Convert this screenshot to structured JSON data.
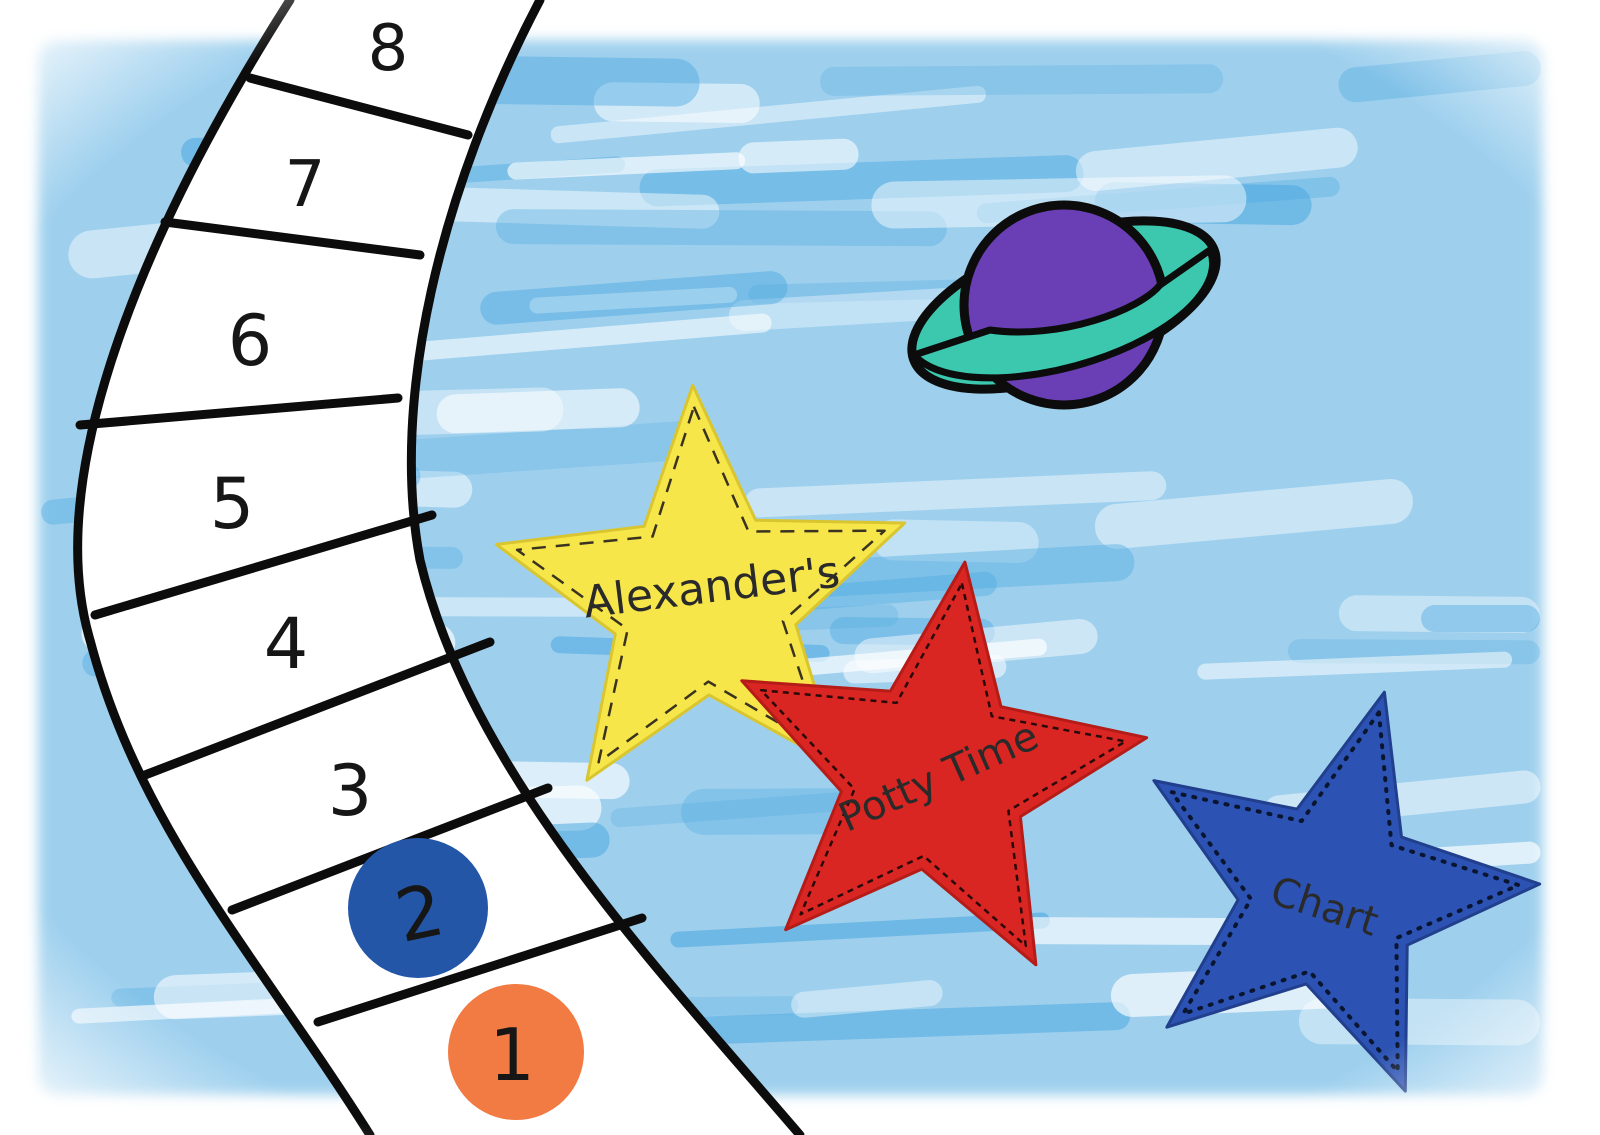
{
  "track": {
    "squares": [
      "1",
      "2",
      "3",
      "4",
      "5",
      "6",
      "7",
      "8"
    ]
  },
  "markers": {
    "blue_token": {
      "label": "2",
      "color": "#2456a8"
    },
    "orange_token": {
      "label": "1",
      "color": "#f27a43"
    }
  },
  "stars": {
    "yellow": {
      "label": "Alexander's",
      "color": "#f7e64a"
    },
    "red": {
      "label": "Potty Time",
      "color": "#d92622"
    },
    "blue": {
      "label": "Chart",
      "color": "#2c53b3"
    }
  },
  "planet": {
    "body_color": "#6a3fb6",
    "ring_color": "#3cc8ae"
  },
  "sky": {
    "paint_color": "#4ea9e0",
    "paper_color": "#ffffff"
  }
}
